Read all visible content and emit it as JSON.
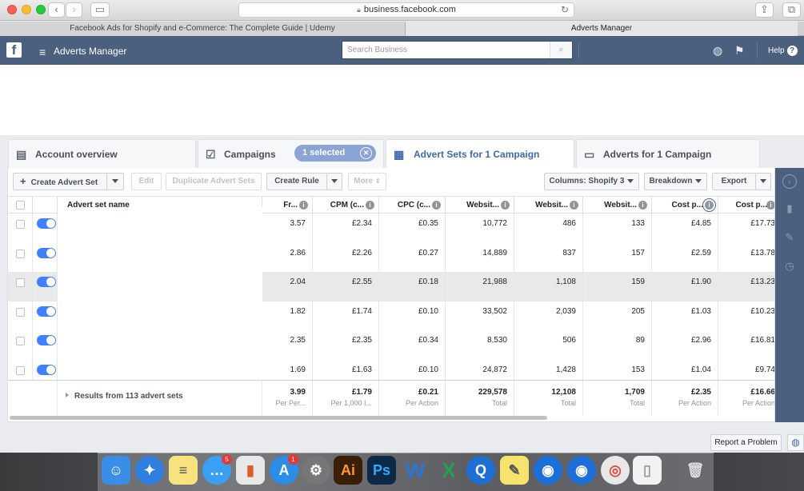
{
  "browser": {
    "url": "business.facebook.com",
    "tabs": [
      {
        "label": "Facebook Ads for Shopify and e-Commerce: The Complete Guide | Udemy"
      },
      {
        "label": "Adverts Manager"
      }
    ]
  },
  "topbar": {
    "title": "Adverts Manager",
    "search_placeholder": "Search Business",
    "help_label": "Help"
  },
  "level_tabs": {
    "account": "Account overview",
    "campaigns": "Campaigns",
    "selected": "1 selected",
    "advert_sets": "Advert Sets for 1 Campaign",
    "adverts": "Adverts for 1 Campaign"
  },
  "toolbar": {
    "create": "Create Advert Set",
    "edit": "Edit",
    "duplicate": "Duplicate Advert Sets",
    "create_rule": "Create Rule",
    "more": "More",
    "columns": "Columns: Shopify 3",
    "breakdown": "Breakdown",
    "export": "Export"
  },
  "table": {
    "headers": [
      "Advert set name",
      "Fr...",
      "CPM (c...",
      "CPC (c...",
      "Websit...",
      "Websit...",
      "Websit...",
      "Cost p...",
      "Cost p..."
    ],
    "rows": [
      [
        "3.57",
        "£2.34",
        "£0.35",
        "10,772",
        "486",
        "133",
        "£4.85",
        "£17.73"
      ],
      [
        "2.86",
        "£2.26",
        "£0.27",
        "14,889",
        "837",
        "157",
        "£2.59",
        "£13.78"
      ],
      [
        "2.04",
        "£2.55",
        "£0.18",
        "21,988",
        "1,108",
        "159",
        "£1.90",
        "£13.23"
      ],
      [
        "1.82",
        "£1.74",
        "£0.10",
        "33,502",
        "2,039",
        "205",
        "£1.03",
        "£10.23"
      ],
      [
        "2.35",
        "£2.35",
        "£0.34",
        "8,530",
        "506",
        "89",
        "£2.96",
        "£16.81"
      ],
      [
        "1.69",
        "£1.63",
        "£0.10",
        "24,872",
        "1,428",
        "153",
        "£1.04",
        "£9.74"
      ]
    ],
    "footer_label": "Results from 113 advert sets",
    "footer": [
      {
        "value": "3.99",
        "sub": "Per Per..."
      },
      {
        "value": "£1.79",
        "sub": "Per 1,000 I..."
      },
      {
        "value": "£0.21",
        "sub": "Per Action"
      },
      {
        "value": "229,578",
        "sub": "Total"
      },
      {
        "value": "12,108",
        "sub": "Total"
      },
      {
        "value": "1,709",
        "sub": "Total"
      },
      {
        "value": "£2.35",
        "sub": "Per Action"
      },
      {
        "value": "£16.66",
        "sub": "Per Action"
      }
    ]
  },
  "report_problem": "Report a Problem",
  "colors": {
    "fb_bar": "#4b5f7f",
    "accent": "#4267b2",
    "toggle_on": "#4080ff"
  }
}
